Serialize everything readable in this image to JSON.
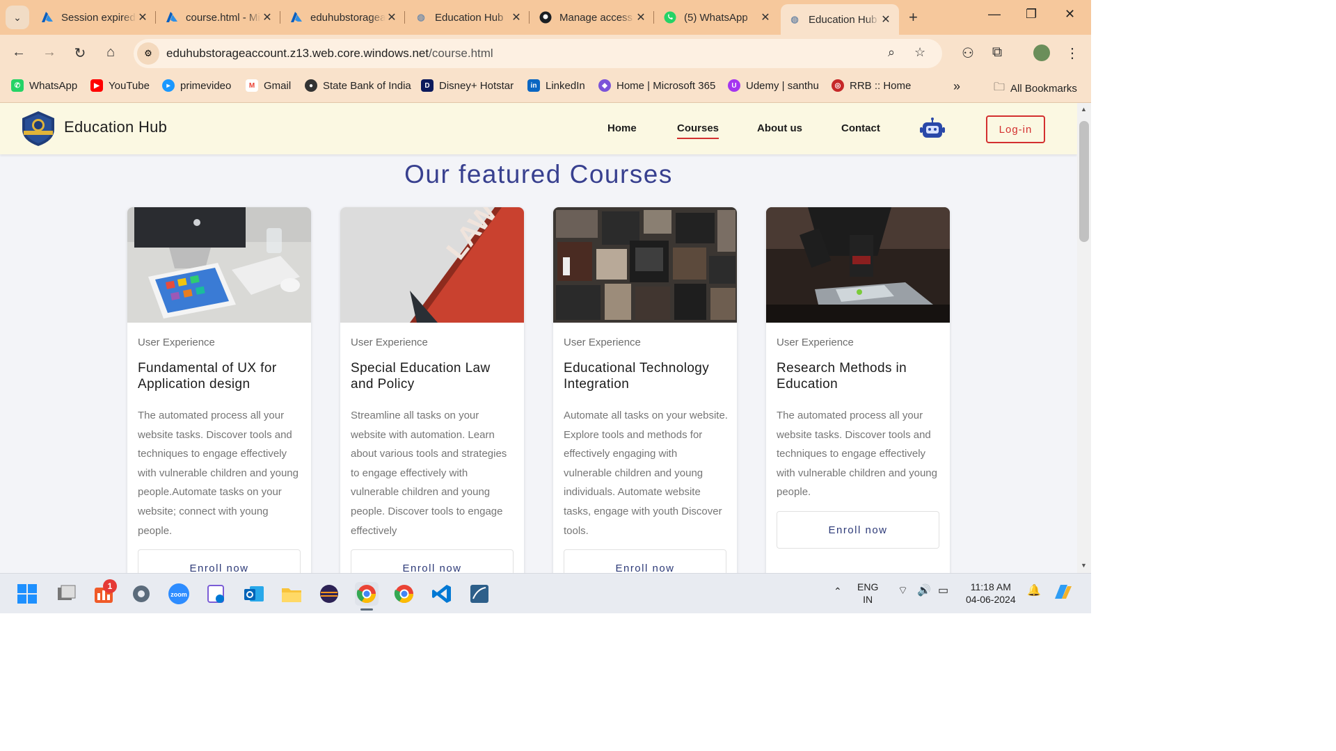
{
  "browser": {
    "tabs": [
      {
        "title": "Session expired",
        "icon": "azure-icon"
      },
      {
        "title": "course.html - Microsoft Azure",
        "icon": "azure-icon"
      },
      {
        "title": "eduhubstorageaccount",
        "icon": "azure-icon"
      },
      {
        "title": "Education Hub",
        "icon": "globe-icon"
      },
      {
        "title": "Manage access",
        "icon": "github-icon"
      },
      {
        "title": "(5) WhatsApp",
        "icon": "whatsapp-icon"
      },
      {
        "title": "Education Hub",
        "icon": "globe-icon"
      }
    ],
    "url_host": "eduhubstorageaccount.z13.web.core.windows.net",
    "url_path": "/course.html",
    "bookmarks": [
      {
        "label": "WhatsApp",
        "color": "#25d366"
      },
      {
        "label": "YouTube",
        "color": "#ff0000"
      },
      {
        "label": "primevideo",
        "color": "#1a98ff"
      },
      {
        "label": "Gmail",
        "color": "#ea4335"
      },
      {
        "label": "State Bank of India",
        "color": "#333333"
      },
      {
        "label": "Disney+ Hotstar",
        "color": "#0c1a5c"
      },
      {
        "label": "LinkedIn",
        "color": "#0a66c2"
      },
      {
        "label": "Home | Microsoft 365",
        "color": "#7b53d9"
      },
      {
        "label": "Udemy | santhu",
        "color": "#a435f0"
      },
      {
        "label": "RRB :: Home",
        "color": "#c62828"
      }
    ],
    "more_bookmarks": "»",
    "all_bookmarks": "All Bookmarks"
  },
  "site": {
    "brand": "Education Hub",
    "nav": [
      "Home",
      "Courses",
      "About us",
      "Contact"
    ],
    "active_nav": "Courses",
    "login": "Log-in",
    "heading": "Our featured Courses",
    "accent": "#d32f2f",
    "heading_color": "#38408f"
  },
  "courses": [
    {
      "category": "User Experience",
      "title": "Fundamental of UX for Application design",
      "description": "The automated process all your website tasks. Discover tools and techniques to engage effectively with vulnerable children and young people.Automate tasks on your website; connect with young people.",
      "button": "Enroll now"
    },
    {
      "category": "User Experience",
      "title": "Special Education Law and Policy",
      "description": "Streamline all tasks on your website with automation. Learn about various tools and strategies to engage effectively with vulnerable children and young people. Discover tools to engage effectively",
      "button": "Enroll now",
      "image_text": "LAW"
    },
    {
      "category": "User Experience",
      "title": "Educational Technology Integration",
      "description": "Automate all tasks on your website. Explore tools and methods for effectively engaging with vulnerable children and young individuals. Automate website tasks, engage with youth Discover tools.",
      "button": "Enroll now"
    },
    {
      "category": "User Experience",
      "title": "Research Methods in Education",
      "description": "The automated process all your website tasks. Discover tools and techniques to engage effectively with vulnerable children and young people.",
      "button": "Enroll now"
    }
  ],
  "taskbar": {
    "language": "ENG",
    "region": "IN",
    "time": "11:18 AM",
    "date": "04-06-2024",
    "badge": "1"
  }
}
